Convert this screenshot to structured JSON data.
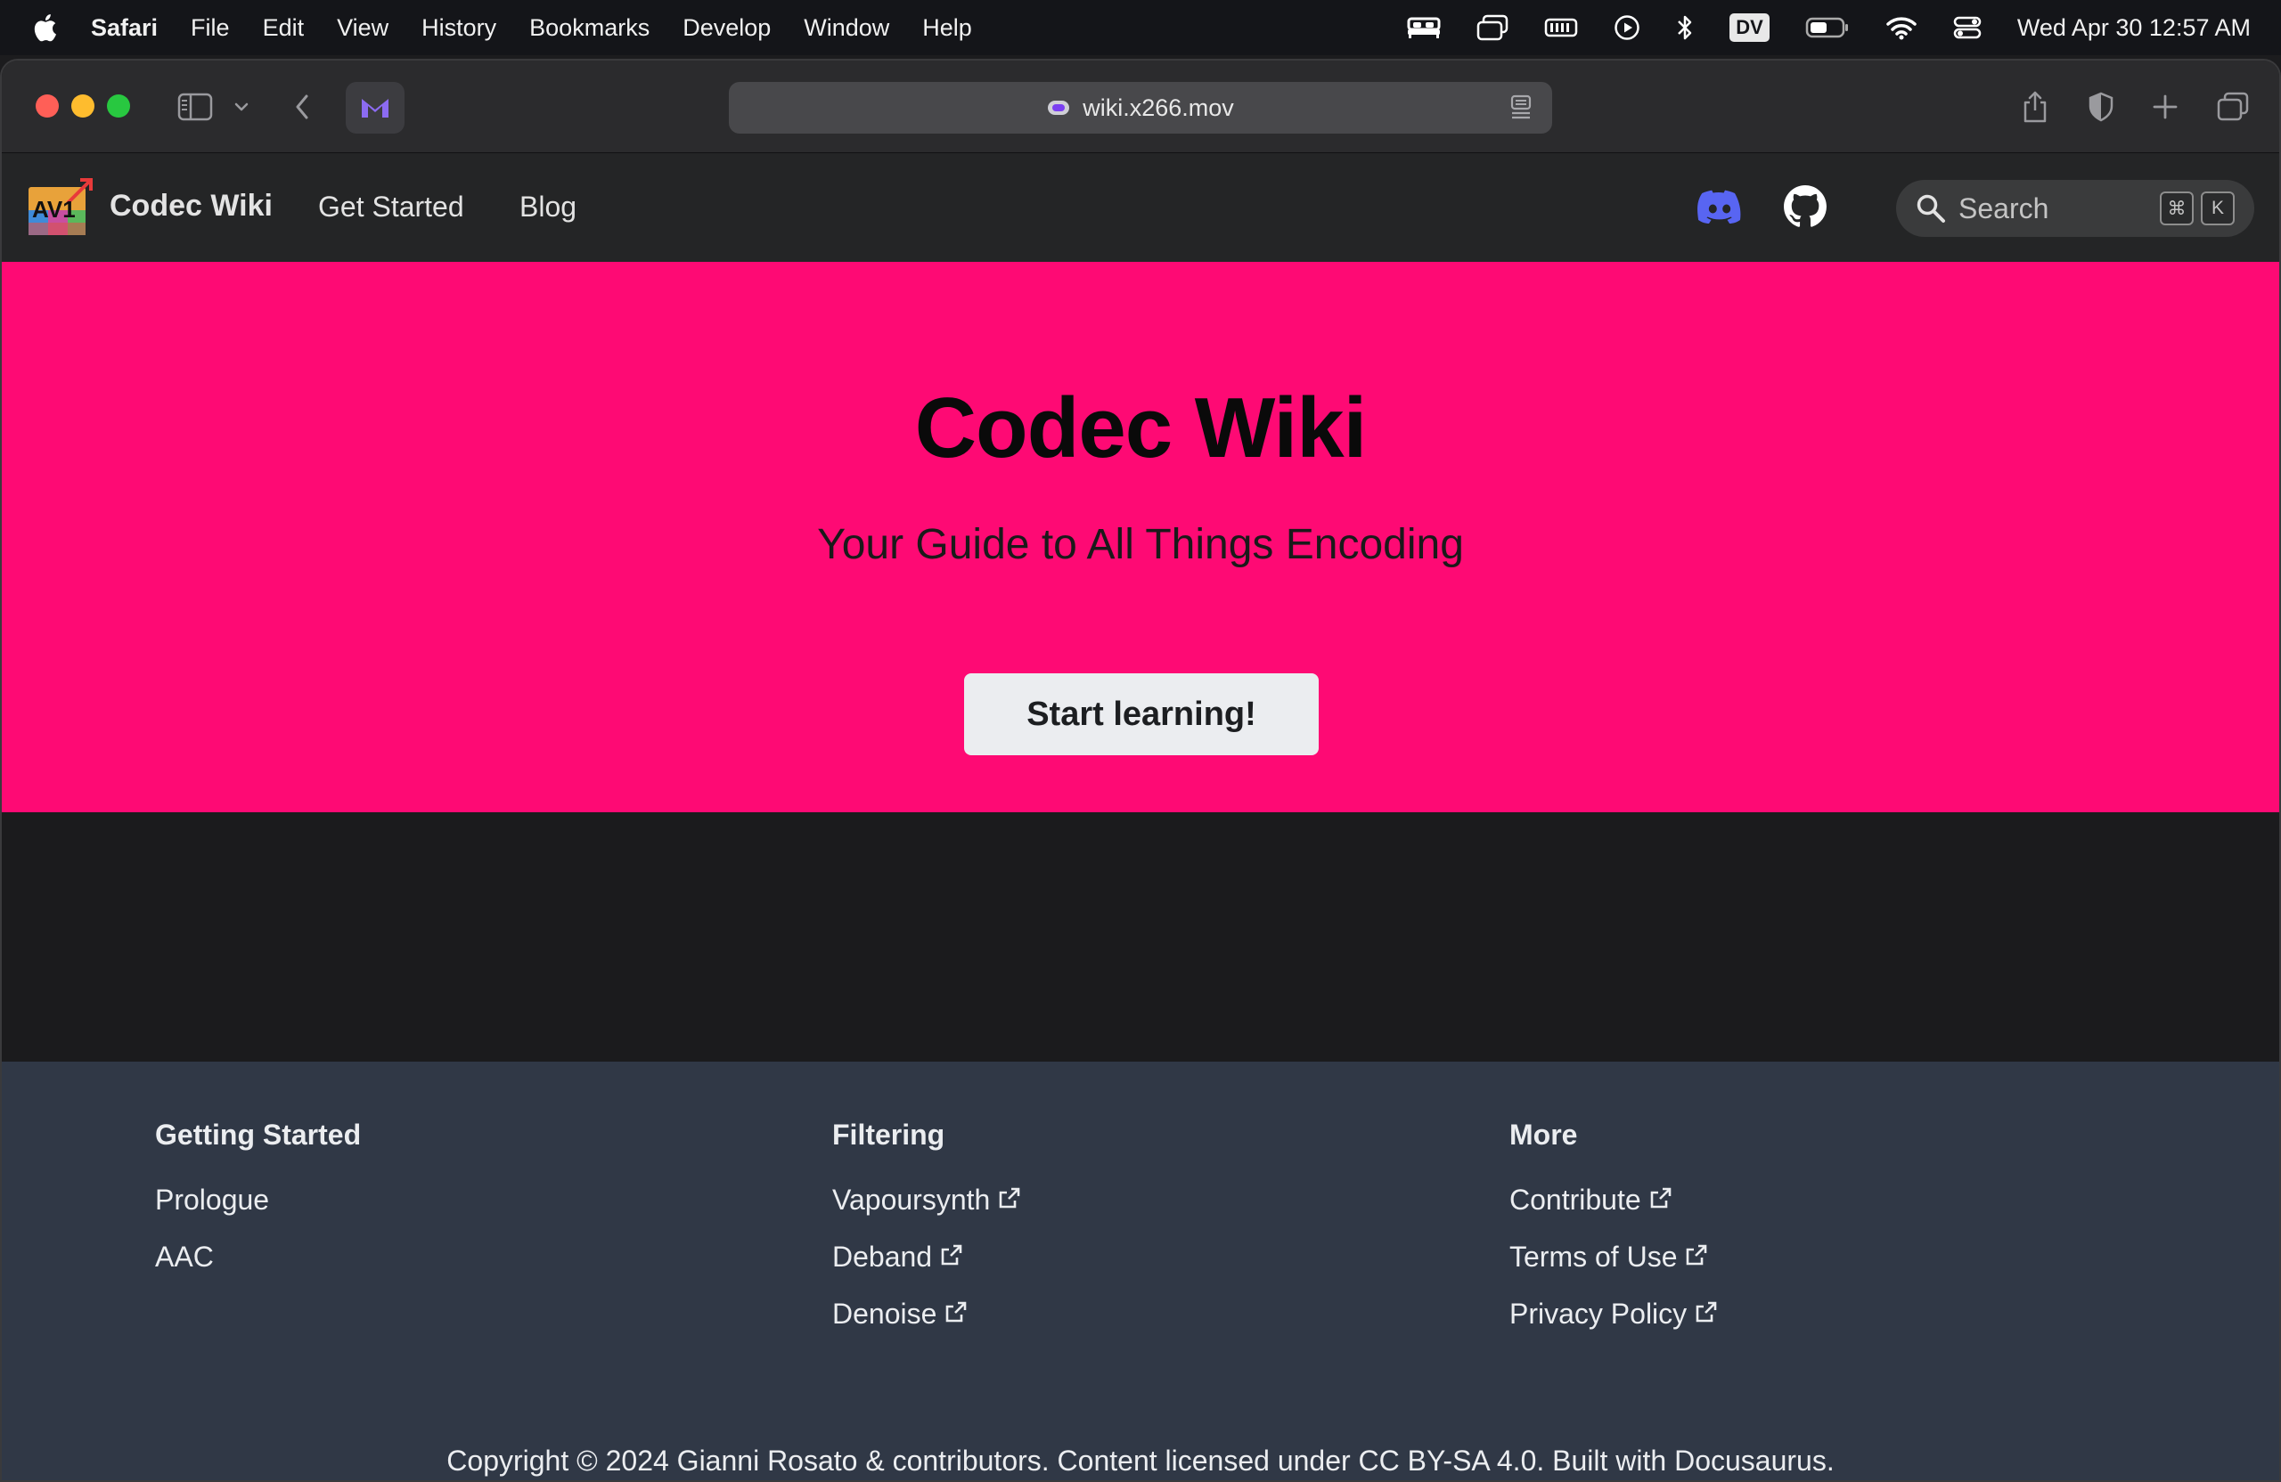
{
  "menubar": {
    "app_name": "Safari",
    "items": [
      "File",
      "Edit",
      "View",
      "History",
      "Bookmarks",
      "Develop",
      "Window",
      "Help"
    ],
    "dv_label": "DV",
    "clock": "Wed Apr 30  12:57 AM",
    "icons": [
      "bed-icon",
      "window-stack-icon",
      "battery-meter-icon",
      "play-circle-icon",
      "bluetooth-icon",
      "dv-icon",
      "battery-icon",
      "wifi-icon",
      "control-center-icon"
    ]
  },
  "browser": {
    "url": "wiki.x266.mov"
  },
  "site_nav": {
    "brand": "Codec Wiki",
    "links": [
      "Get Started",
      "Blog"
    ],
    "search_placeholder": "Search",
    "kbd_cmd": "⌘",
    "kbd_key": "K"
  },
  "hero": {
    "title": "Codec Wiki",
    "subtitle": "Your Guide to All Things Encoding",
    "cta": "Start learning!"
  },
  "footer": {
    "columns": [
      {
        "title": "Getting Started",
        "links": [
          {
            "label": "Prologue",
            "external": false
          },
          {
            "label": "AAC",
            "external": false
          }
        ]
      },
      {
        "title": "Filtering",
        "links": [
          {
            "label": "Vapoursynth",
            "external": true
          },
          {
            "label": "Deband",
            "external": true
          },
          {
            "label": "Denoise",
            "external": true
          }
        ]
      },
      {
        "title": "More",
        "links": [
          {
            "label": "Contribute",
            "external": true
          },
          {
            "label": "Terms of Use",
            "external": true
          },
          {
            "label": "Privacy Policy",
            "external": true
          }
        ]
      }
    ],
    "copyright": "Copyright © 2024 Gianni Rosato & contributors. Content licensed under CC BY-SA 4.0. Built with Docusaurus."
  },
  "colors": {
    "hero_bg": "#fe0a74",
    "navbar_bg": "#242526",
    "footer_bg": "#303846",
    "discord": "#5865f2"
  }
}
